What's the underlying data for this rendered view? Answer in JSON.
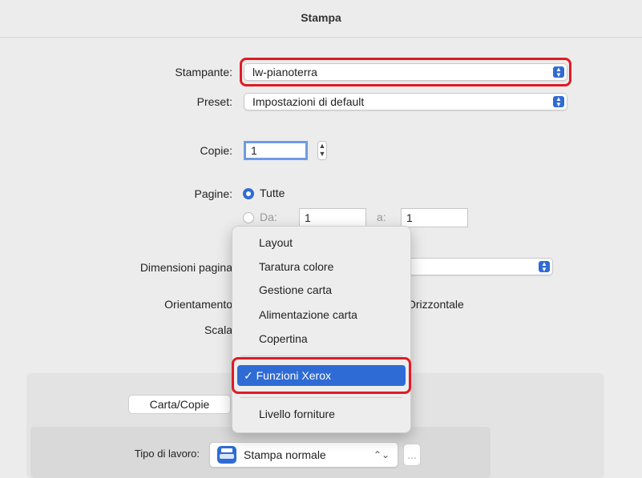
{
  "window": {
    "title": "Stampa"
  },
  "printer": {
    "label": "Stampante:",
    "value": "lw-pianoterra"
  },
  "preset": {
    "label": "Preset:",
    "value": "Impostazioni di default"
  },
  "copies": {
    "label": "Copie:",
    "value": "1"
  },
  "pages": {
    "label": "Pagine:",
    "all_label": "Tutte",
    "range_from_label": "Da:",
    "range_from_value": "1",
    "range_to_label": "a:",
    "range_to_value": "1"
  },
  "page_size": {
    "label": "Dimensioni pagina"
  },
  "orientation": {
    "label": "Orientamento",
    "horizontal_label": "Orizzontale"
  },
  "scale": {
    "label": "Scala"
  },
  "tabs": {
    "paper_copies": "Carta/Copie"
  },
  "job_type": {
    "label": "Tipo di lavoro:",
    "value": "Stampa normale",
    "more": "..."
  },
  "menu": {
    "items": [
      "Layout",
      "Taratura colore",
      "Gestione carta",
      "Alimentazione carta",
      "Copertina"
    ],
    "selected": "Funzioni Xerox",
    "checkmark": "✓",
    "footer": "Livello forniture"
  },
  "colors": {
    "accent": "#2f6bd4",
    "highlight_border": "#e01b24"
  },
  "icons": {
    "popup": "updown-arrows-icon",
    "printer": "printer-icon"
  }
}
